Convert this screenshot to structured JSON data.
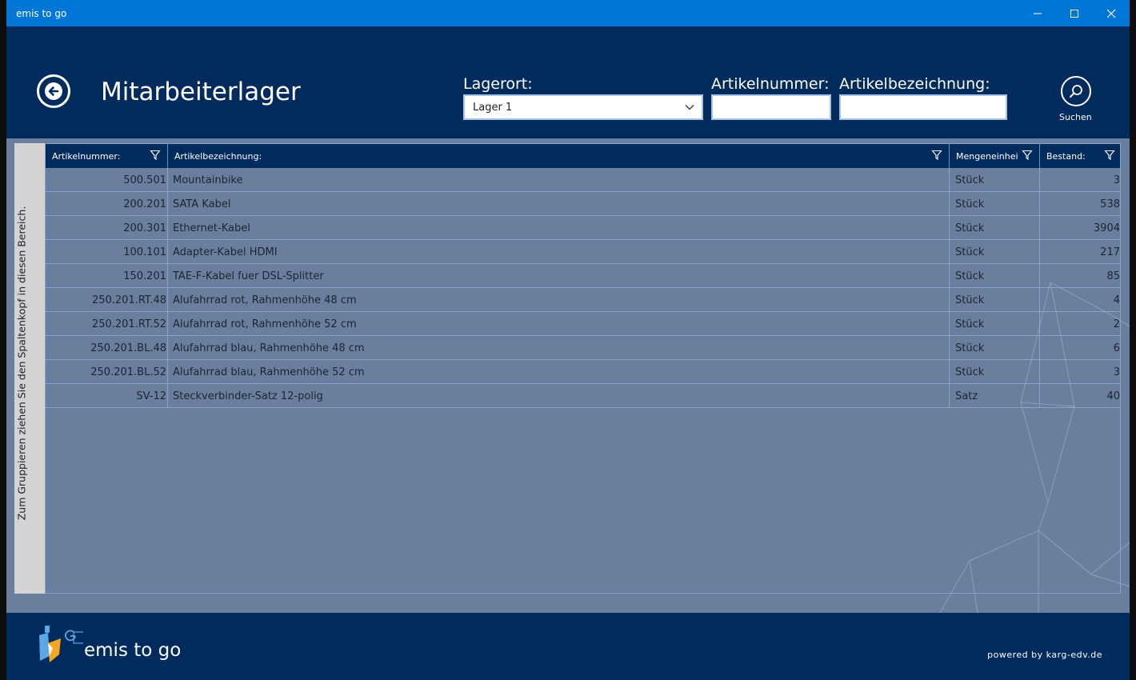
{
  "window": {
    "title": "emis to go"
  },
  "header": {
    "page_title": "Mitarbeiterlager",
    "lagerort_label": "Lagerort:",
    "lagerort_value": "Lager 1",
    "artikelnummer_label": "Artikelnummer:",
    "artikelnummer_value": "",
    "artikelbezeichnung_label": "Artikelbezeichnung:",
    "artikelbezeichnung_value": "",
    "search_label": "Suchen"
  },
  "grid": {
    "group_hint": "Zum Gruppieren ziehen Sie den Spaltenkopf in diesen Bereich.",
    "columns": [
      "Artikelnummer:",
      "Artikelbezeichnung:",
      "Mengeneinheit",
      "Bestand:"
    ],
    "rows": [
      {
        "nr": "500.501",
        "bez": "Mountainbike",
        "me": "Stück",
        "bestand": "3"
      },
      {
        "nr": "200.201",
        "bez": "SATA Kabel",
        "me": "Stück",
        "bestand": "538"
      },
      {
        "nr": "200.301",
        "bez": "Ethernet-Kabel",
        "me": "Stück",
        "bestand": "3904"
      },
      {
        "nr": "100.101",
        "bez": "Adapter-Kabel HDMI",
        "me": "Stück",
        "bestand": "217"
      },
      {
        "nr": "150.201",
        "bez": "TAE-F-Kabel fuer DSL-Splitter",
        "me": "Stück",
        "bestand": "85"
      },
      {
        "nr": "250.201.RT.48",
        "bez": "Alufahrrad rot, Rahmenhöhe 48 cm",
        "me": "Stück",
        "bestand": "4"
      },
      {
        "nr": "250.201.RT.52",
        "bez": "Alufahrrad rot, Rahmenhöhe 52 cm",
        "me": "Stück",
        "bestand": "2"
      },
      {
        "nr": "250.201.BL.48",
        "bez": "Alufahrrad blau, Rahmenhöhe 48 cm",
        "me": "Stück",
        "bestand": "6"
      },
      {
        "nr": "250.201.BL.52",
        "bez": "Alufahrrad blau, Rahmenhöhe 52 cm",
        "me": "Stück",
        "bestand": "3"
      },
      {
        "nr": "SV-12",
        "bez": "Steckverbinder-Satz 12-polig",
        "me": "Satz",
        "bestand": "40"
      }
    ]
  },
  "footer": {
    "brand": "emis to go",
    "powered": "powered by karg-edv.de"
  },
  "colors": {
    "titlebar": "#0077d6",
    "navy": "#002b5c",
    "grid_bg": "#6a7f9d",
    "logo_blue": "#5aa9e6",
    "logo_orange": "#f5a623"
  },
  "icons": [
    "back-arrow-icon",
    "search-icon",
    "filter-icon",
    "chevron-down-icon",
    "minimize-icon",
    "maximize-icon",
    "close-icon",
    "app-logo-icon"
  ]
}
